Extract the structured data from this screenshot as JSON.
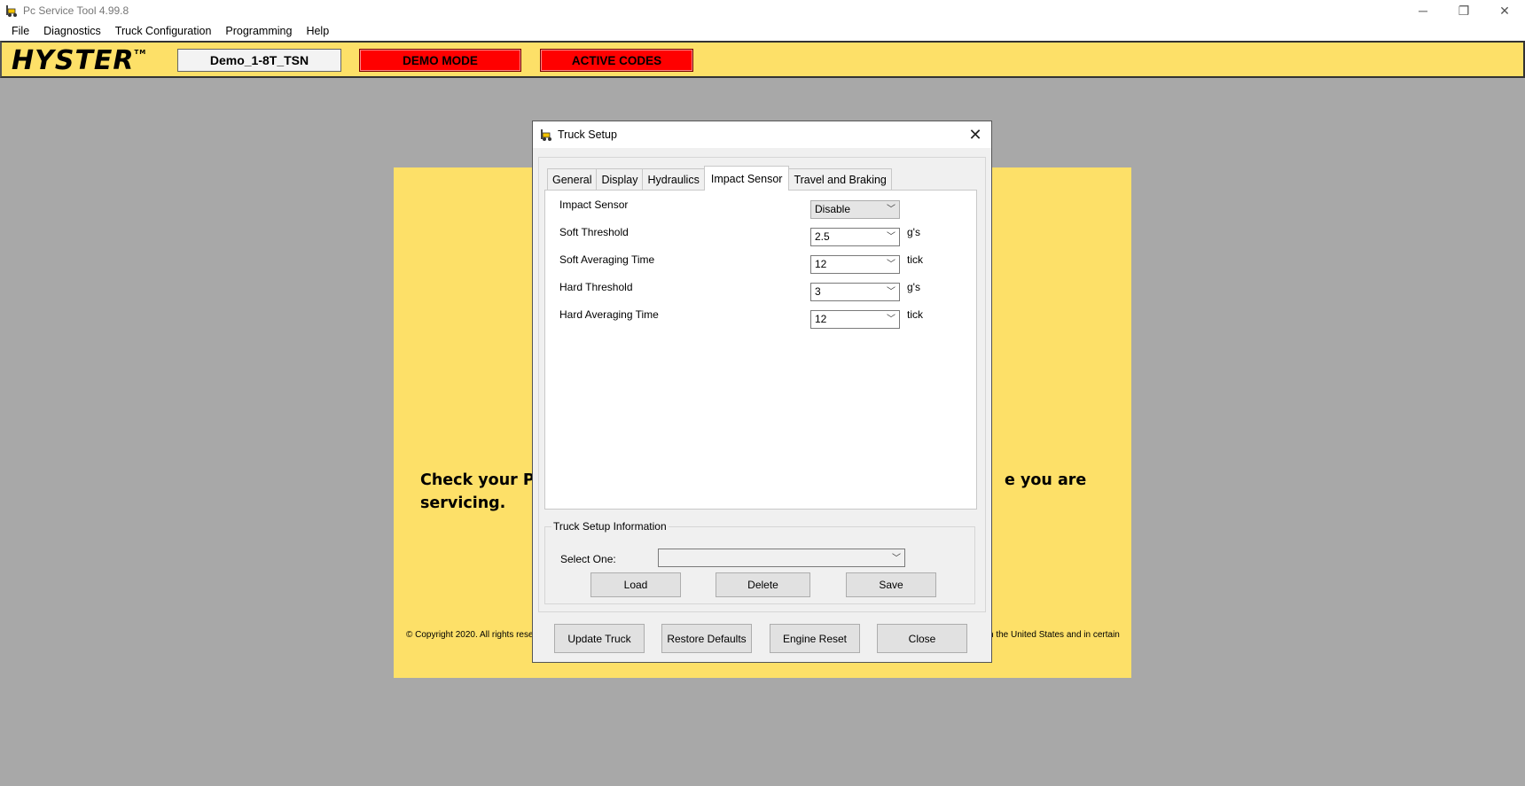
{
  "window": {
    "title": "Pc Service Tool 4.99.8",
    "minimize": "─",
    "restore": "❐",
    "close": "✕"
  },
  "menu": [
    "File",
    "Diagnostics",
    "Truck Configuration",
    "Programming",
    "Help"
  ],
  "header": {
    "logo": "HYSTER",
    "logo_tm": "TM",
    "truck_id": "Demo_1-8T_TSN",
    "demo_mode": "DEMO MODE",
    "active_codes": "ACTIVE CODES"
  },
  "background": {
    "message_left": "Check your Par",
    "message_left_2": "servicing.",
    "message_right": "e you are",
    "copyright_left": "© Copyright 2020. All rights rese",
    "copyright_right": "n the United States and in certain"
  },
  "dialog": {
    "title": "Truck Setup",
    "tabs": [
      "General",
      "Display",
      "Hydraulics",
      "Impact Sensor",
      "Travel and Braking"
    ],
    "active_tab": "Impact Sensor",
    "fields": [
      {
        "label": "Impact Sensor",
        "value": "Disable",
        "unit": ""
      },
      {
        "label": "Soft Threshold",
        "value": "2.5",
        "unit": "g's"
      },
      {
        "label": "Soft Averaging Time",
        "value": "12",
        "unit": "tick"
      },
      {
        "label": "Hard Threshold",
        "value": "3",
        "unit": "g's"
      },
      {
        "label": "Hard Averaging Time",
        "value": "12",
        "unit": "tick"
      }
    ],
    "setup_info": {
      "title": "Truck Setup Information",
      "select_label": "Select One:",
      "select_value": "",
      "load": "Load",
      "delete": "Delete",
      "save": "Save"
    },
    "buttons": {
      "update": "Update Truck",
      "restore": "Restore Defaults",
      "engine_reset": "Engine Reset",
      "close": "Close"
    }
  },
  "colors": {
    "brand_yellow": "#fde068",
    "badge_red": "#ff0000",
    "workspace_grey": "#a8a8a8"
  }
}
